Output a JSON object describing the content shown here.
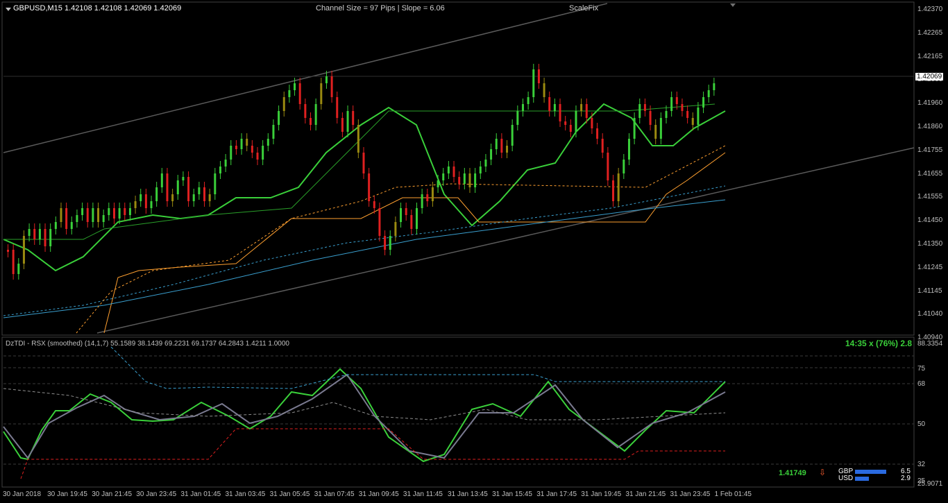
{
  "symbol_header": "GBPUSD,M15  1.42108 1.42108 1.42069 1.42069",
  "channel_info": "Channel Size = 97 Pips  |  Slope = 6.06",
  "scalefix_label": "ScaleFix",
  "current_price": "1.42069",
  "price_ticks": [
    "1.42370",
    "1.42265",
    "1.42165",
    "1.42060",
    "1.41960",
    "1.41860",
    "1.41755",
    "1.41655",
    "1.41555",
    "1.41450",
    "1.41350",
    "1.41245",
    "1.41145",
    "1.41040",
    "1.40940"
  ],
  "indicator_header": "DzTDI - RSX (smoothed) (14,1,7) 55.1589 38.1439 69.2231 69.1737 64.2843 1.4211 1.0000",
  "indicator_status": "14:35 x (76%) 2.8",
  "indicator_ticks": {
    "top": "88.3354",
    "t75": "75",
    "t68": "68",
    "t50": "50",
    "t32": "32",
    "t25": "25",
    "bottom": "25.9071"
  },
  "indicator_price": "1.41749",
  "arrow_glyph": "⇩",
  "currency_strength": [
    {
      "name": "GBP",
      "value": "6.5",
      "level": 6.5
    },
    {
      "name": "USD",
      "value": "2.9",
      "level": 2.9
    }
  ],
  "time_labels": [
    "30 Jan 2018",
    "30 Jan 19:45",
    "30 Jan 21:45",
    "30 Jan 23:45",
    "31 Jan 01:45",
    "31 Jan 03:45",
    "31 Jan 05:45",
    "31 Jan 07:45",
    "31 Jan 09:45",
    "31 Jan 11:45",
    "31 Jan 13:45",
    "31 Jan 15:45",
    "31 Jan 17:45",
    "31 Jan 19:45",
    "31 Jan 21:45",
    "31 Jan 23:45",
    "1 Feb 01:45"
  ],
  "colors": {
    "background": "#000000",
    "bull_candle": "#3ad03a",
    "bear_candle": "#e02020",
    "neutral_candle": "#9a8a10",
    "price_ma": "#3ad03a",
    "channel_line": "#606060",
    "orange_band": "#ffa030",
    "blue_line": "#3aa0d0",
    "rsx_green": "#3ad03a",
    "rsx_red": "#e02020",
    "signal_line": "#7a7a90",
    "strength_bar": "#2a6ae0",
    "status_text": "#3ad03a",
    "arrow": "#ff6030"
  }
}
